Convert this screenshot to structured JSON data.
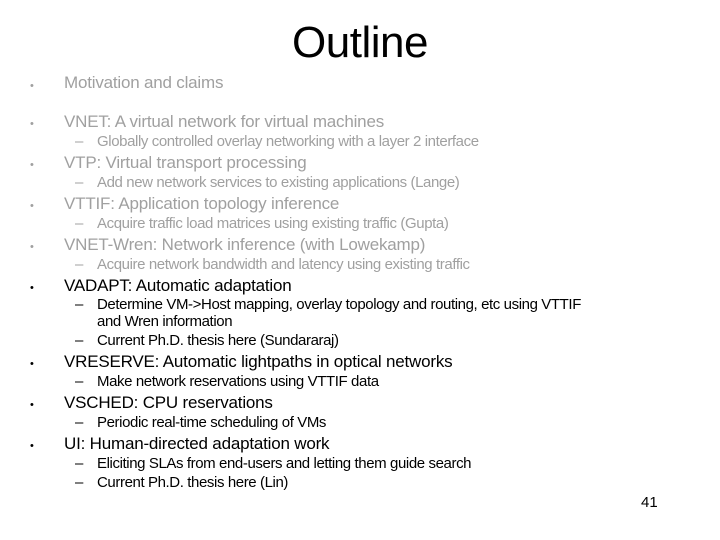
{
  "slide": {
    "title": "Outline",
    "page_number": "41",
    "colors": {
      "dimmed_text": "#a0a0a0",
      "active_text": "#000000"
    },
    "items": [
      {
        "label": "Motivation and claims",
        "state": "dimmed",
        "subitems": []
      },
      {
        "label": "VNET: A virtual network for virtual machines",
        "state": "dimmed",
        "subitems": [
          "Globally controlled overlay networking with a layer 2 interface"
        ]
      },
      {
        "label": "VTP: Virtual transport processing",
        "state": "dimmed",
        "subitems": [
          "Add new network services to existing applications (Lange)"
        ]
      },
      {
        "label": "VTTIF: Application topology inference",
        "state": "dimmed",
        "subitems": [
          "Acquire traffic load matrices using existing traffic (Gupta)"
        ]
      },
      {
        "label": "VNET-Wren: Network inference (with Lowekamp)",
        "state": "dimmed",
        "subitems": [
          "Acquire network bandwidth and latency using existing traffic"
        ]
      },
      {
        "label": "VADAPT: Automatic adaptation",
        "state": "active",
        "subitems": [
          "Determine VM->Host mapping, overlay topology and routing, etc using VTTIF",
          "and Wren information",
          "Current Ph.D. thesis here (Sundararaj)"
        ]
      },
      {
        "label": "VRESERVE: Automatic lightpaths in optical networks",
        "state": "active",
        "subitems": [
          "Make network reservations using VTTIF data"
        ]
      },
      {
        "label": "VSCHED: CPU reservations",
        "state": "active",
        "subitems": [
          "Periodic real-time scheduling of VMs"
        ]
      },
      {
        "label": "UI: Human-directed adaptation work",
        "state": "active",
        "subitems": [
          "Eliciting SLAs from end-users and letting them guide search",
          "Current Ph.D. thesis here (Lin)"
        ]
      }
    ],
    "bullet_glyph": "•",
    "dash_glyph": "–"
  }
}
